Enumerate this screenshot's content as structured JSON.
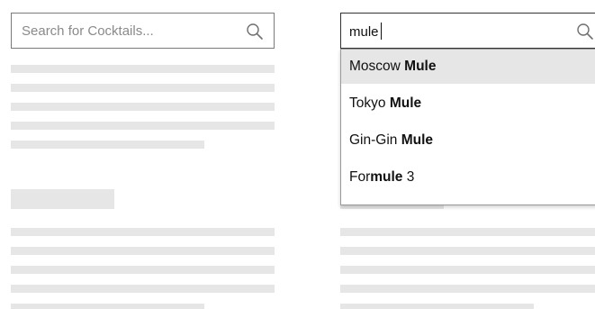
{
  "left_search": {
    "placeholder": "Search for Cocktails..."
  },
  "right_search": {
    "value": "mule"
  },
  "suggestions": [
    {
      "prefix": "Moscow ",
      "match": "Mule",
      "suffix": "",
      "highlighted": true
    },
    {
      "prefix": "Tokyo ",
      "match": "Mule",
      "suffix": "",
      "highlighted": false
    },
    {
      "prefix": "Gin-Gin ",
      "match": "Mule",
      "suffix": "",
      "highlighted": false
    },
    {
      "prefix": "For",
      "match": "mule",
      "suffix": " 3",
      "highlighted": false
    }
  ],
  "icons": {
    "search": "search-icon"
  },
  "colors": {
    "placeholder_bar": "#e6e6e6",
    "highlight": "#e6e6e6",
    "border": "#7a7a7a"
  }
}
